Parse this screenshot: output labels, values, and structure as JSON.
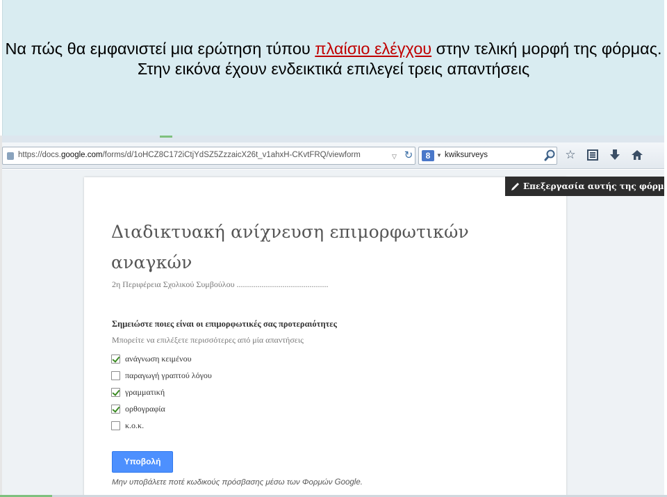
{
  "caption": {
    "before": "Να πώς θα εμφανιστεί μια ερώτηση τύπου ",
    "link": "πλαίσιο ελέγχου",
    "after": " στην τελική μορφή της φόρμας. Στην εικόνα έχουν ενδεικτικά επιλεγεί τρεις απαντήσεις"
  },
  "browser": {
    "url_prefix": "https://docs.",
    "url_domain": "google.com",
    "url_rest": "/forms/d/1oHCZ8C172iCtjYdSZ5ZzzaicX26t_v1ahxH-CKvtFRQ/viewform",
    "search_value": "kwiksurveys",
    "search_engine_letter": "8",
    "icons": [
      "star-icon",
      "bookmarks-icon",
      "download-icon",
      "home-icon"
    ]
  },
  "form": {
    "edit_button": "Επεξεργασία αυτής της φόρμας",
    "title": "Διαδικτυακή ανίχνευση επιμορφωτικών αναγκών",
    "description": "2η Περιφέρεια Σχολικού Συμβούλου ............................................",
    "question": {
      "title": "Σημειώστε ποιες είναι οι επιμορφωτικές σας προτεραιότητες",
      "help": "Μπορείτε να επιλέξετε περισσότερες από μία απαντήσεις",
      "options": [
        {
          "label": "ανάγνωση κειμένου",
          "checked": true
        },
        {
          "label": "παραγωγή γραπτού λόγου",
          "checked": false
        },
        {
          "label": "γραμματική",
          "checked": true
        },
        {
          "label": "ορθογραφία",
          "checked": true
        },
        {
          "label": "κ.ο.κ.",
          "checked": false
        }
      ]
    },
    "submit_label": "Υποβολή",
    "footer_note": "Μην υποβάλετε ποτέ κωδικούς πρόσβασης μέσω των Φορμών Google."
  },
  "colors": {
    "caption_bg": "#d9ecf1",
    "link": "#c00000",
    "submit_bg": "#4d90fe",
    "edit_button_bg": "#2d2d2d",
    "checkmark": "#3a8a22"
  }
}
